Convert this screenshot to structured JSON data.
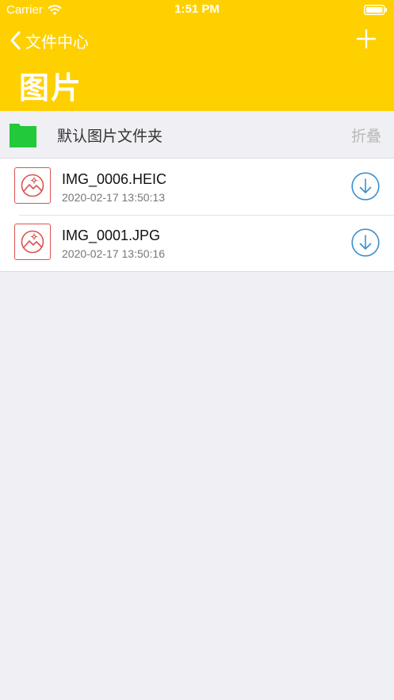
{
  "status_bar": {
    "carrier": "Carrier",
    "time": "1:51 PM"
  },
  "nav": {
    "back_label": "文件中心",
    "title": "图片"
  },
  "folder": {
    "name": "默认图片文件夹",
    "collapse_label": "折叠"
  },
  "files": [
    {
      "name": "IMG_0006.HEIC",
      "date": "2020-02-17 13:50:13"
    },
    {
      "name": "IMG_0001.JPG",
      "date": "2020-02-17 13:50:16"
    }
  ],
  "colors": {
    "header": "#ffd000",
    "folder_icon": "#22c93a",
    "thumb_accent": "#d9534f",
    "download_accent": "#3a8fd0",
    "background": "#efeff4"
  },
  "icons": {
    "back": "chevron-left-icon",
    "add": "plus-icon",
    "folder": "folder-icon",
    "thumbnail": "image-icon",
    "download": "download-icon",
    "wifi": "wifi-icon",
    "battery": "battery-icon"
  }
}
